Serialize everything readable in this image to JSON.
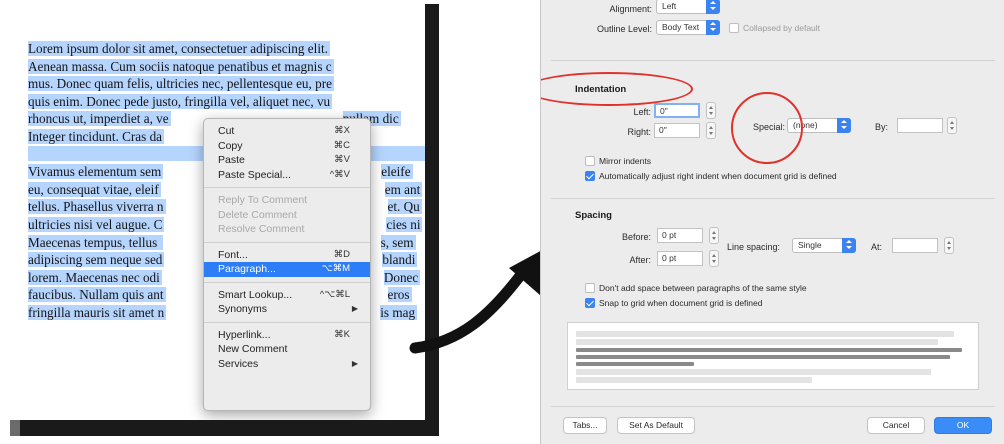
{
  "document": {
    "lines": [
      "Lorem ipsum dolor sit amet, consectetuer adipiscing elit.",
      "Aenean massa. Cum sociis natoque penatibus et magnis c",
      "mus. Donec quam felis, ultricies nec, pellentesque eu, pre",
      "quis enim. Donec pede justo, fringilla vel, aliquet nec, vu",
      "rhoncus ut, imperdiet a, ve",
      "Integer tincidunt. Cras da",
      "",
      "Vivamus elementum sem",
      "eu, consequat vitae, eleif",
      "tellus. Phasellus viverra n",
      "ultricies nisi vel augue. C",
      "Maecenas tempus, tellus ",
      "adipiscing sem neque sed",
      "lorem. Maecenas nec odi",
      "faucibus. Nullam quis ant",
      "fringilla mauris sit amet n"
    ],
    "right_fragments": {
      "line5": "nullam dic",
      "line8": "eleife",
      "line9": "em ant",
      "line10": "et. Qu",
      "line11": "cies ni",
      "line12": "s, sem",
      "line13": "blandi",
      "line14": "Donec",
      "line15": "eros",
      "line16": "is mag"
    }
  },
  "context_menu": {
    "items": [
      {
        "label": "Cut",
        "shortcut": "⌘X",
        "state": "normal"
      },
      {
        "label": "Copy",
        "shortcut": "⌘C",
        "state": "normal"
      },
      {
        "label": "Paste",
        "shortcut": "⌘V",
        "state": "normal"
      },
      {
        "label": "Paste Special...",
        "shortcut": "^⌘V",
        "state": "normal"
      },
      {
        "sep": true
      },
      {
        "label": "Reply To Comment",
        "shortcut": "",
        "state": "disabled"
      },
      {
        "label": "Delete Comment",
        "shortcut": "",
        "state": "disabled"
      },
      {
        "label": "Resolve Comment",
        "shortcut": "",
        "state": "disabled"
      },
      {
        "sep": true
      },
      {
        "label": "Font...",
        "shortcut": "⌘D",
        "state": "normal"
      },
      {
        "label": "Paragraph...",
        "shortcut": "⌥⌘M",
        "state": "active"
      },
      {
        "sep": true
      },
      {
        "label": "Smart Lookup...",
        "shortcut": "^⌥⌘L",
        "state": "normal"
      },
      {
        "label": "Synonyms",
        "shortcut": "",
        "state": "submenu"
      },
      {
        "sep": true
      },
      {
        "label": "Hyperlink...",
        "shortcut": "⌘K",
        "state": "normal"
      },
      {
        "label": "New Comment",
        "shortcut": "",
        "state": "normal"
      },
      {
        "label": "Services",
        "shortcut": "",
        "state": "submenu"
      }
    ]
  },
  "dialog": {
    "general": {
      "alignment_label": "Alignment:",
      "alignment_value": "Left",
      "outline_label": "Outline Level:",
      "outline_value": "Body Text",
      "collapsed_label": "Collapsed by default",
      "collapsed_checked": false
    },
    "indentation": {
      "title": "Indentation",
      "left_label": "Left:",
      "left_value": "0\"",
      "right_label": "Right:",
      "right_value": "0\"",
      "special_label": "Special:",
      "special_value": "(none)",
      "by_label": "By:",
      "by_value": "",
      "mirror_label": "Mirror indents",
      "mirror_checked": false,
      "auto_adjust_label": "Automatically adjust right indent when document grid is defined",
      "auto_adjust_checked": true
    },
    "spacing": {
      "title": "Spacing",
      "before_label": "Before:",
      "before_value": "0 pt",
      "after_label": "After:",
      "after_value": "0 pt",
      "line_spacing_label": "Line spacing:",
      "line_spacing_value": "Single",
      "at_label": "At:",
      "at_value": "",
      "dont_add_label": "Don't add space between paragraphs of the same style",
      "dont_add_checked": false,
      "snap_label": "Snap to grid when document grid is defined",
      "snap_checked": true
    },
    "buttons": {
      "tabs": "Tabs...",
      "set_default": "Set As Default",
      "cancel": "Cancel",
      "ok": "OK"
    },
    "highlight_color": "#e0322b",
    "accent_color": "#3a83f1"
  }
}
